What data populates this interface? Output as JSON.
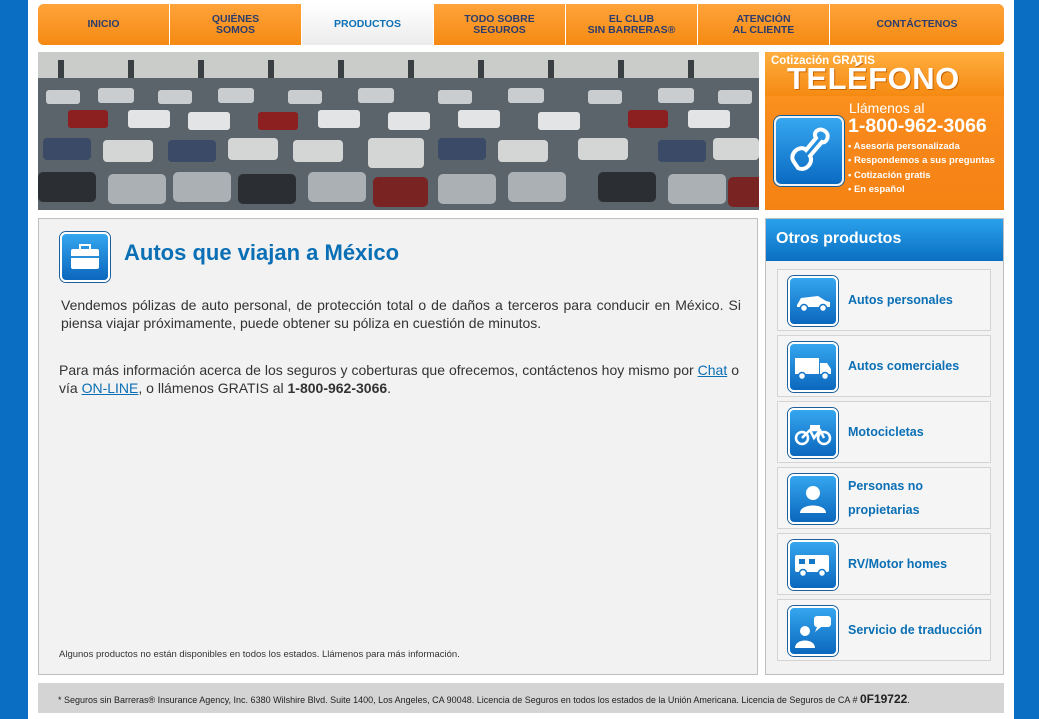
{
  "nav": {
    "items": [
      {
        "label": "INICIO",
        "active": false
      },
      {
        "label": "QUIÉNES\nSOMOS",
        "active": false
      },
      {
        "label": "PRODUCTOS",
        "active": true
      },
      {
        "label": "TODO SOBRE\nSEGUROS",
        "active": false
      },
      {
        "label": "EL CLUB\nSIN BARRERAS®",
        "active": false
      },
      {
        "label": "ATENCIÓN\nAL CLIENTE",
        "active": false
      },
      {
        "label": "CONTÁCTENOS",
        "active": false
      }
    ]
  },
  "promo": {
    "kicker": "Cotización GRATIS",
    "title": "TELÉFONO",
    "call": "Llámenos al",
    "number": "1-800-962-3066",
    "bullets": [
      "Asesoría personalizada",
      "Respondemos a sus preguntas",
      "Cotización gratis",
      "En español"
    ]
  },
  "main": {
    "title": "Autos que viajan a México",
    "para1": "Vendemos pólizas de auto personal, de protección total o de daños a terceros para conducir en México. Si piensa viajar próximamente, puede obtener su póliza en cuestión de minutos.",
    "para2_pre": "Para más información acerca de los seguros y coberturas que ofrecemos, contáctenos hoy mismo por ",
    "chat_link": "Chat",
    "para2_mid": " o vía ",
    "online_link": "ON-LINE",
    "para2_post": ", o llámenos GRATIS al ",
    "para2_phone": "1-800-962-3066",
    "para2_end": ".",
    "footnote": "Algunos productos no están disponibles en todos los estados. Llámenos para más información."
  },
  "sidebar": {
    "title": "Otros productos",
    "items": [
      {
        "label": "Autos personales",
        "icon": "car-icon"
      },
      {
        "label": "Autos comerciales",
        "icon": "truck-icon"
      },
      {
        "label": "Motocicletas",
        "icon": "motorcycle-icon"
      },
      {
        "label": "Personas no propietarias",
        "icon": "person-icon"
      },
      {
        "label": "RV/Motor homes",
        "icon": "rv-icon"
      },
      {
        "label": "Servicio de traducción",
        "icon": "translation-icon"
      }
    ]
  },
  "footer": {
    "text": "* Seguros sin Barreras® Insurance Agency, Inc. 6380 Wilshire Blvd. Suite 1400, Los Angeles, CA 90048. Licencia de Seguros en todos los estados de la Unión Americana. Licencia de Seguros de CA # ",
    "license": "0F19722",
    "end": "."
  }
}
